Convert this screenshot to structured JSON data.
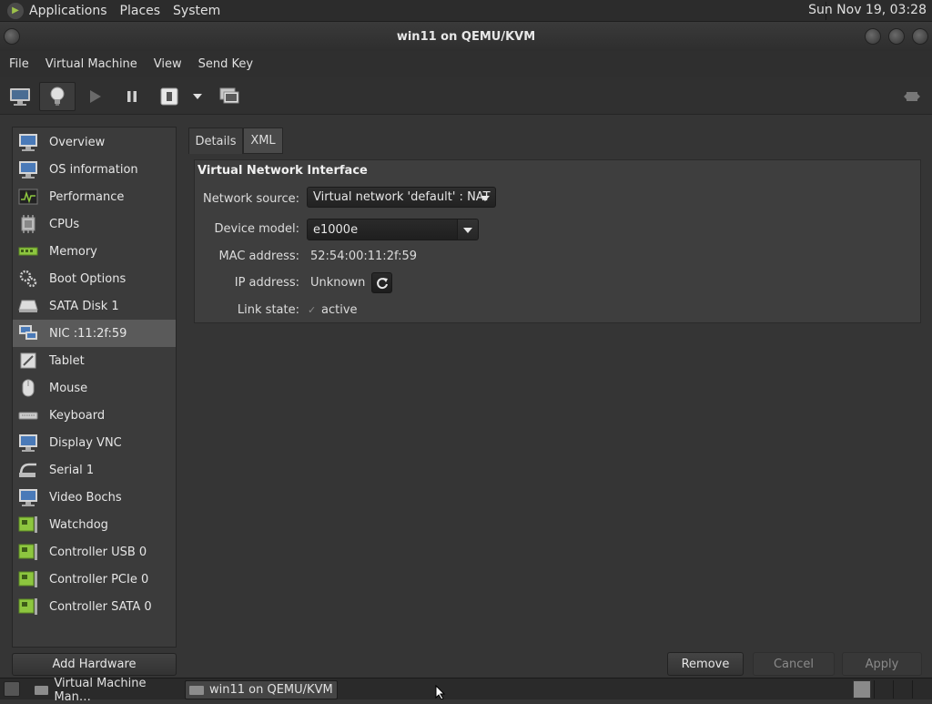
{
  "top_panel": {
    "menus": [
      "Applications",
      "Places",
      "System"
    ],
    "clock": "Sun Nov 19, 03:28"
  },
  "window": {
    "title": "win11 on QEMU/KVM"
  },
  "menubar": [
    "File",
    "Virtual Machine",
    "View",
    "Send Key"
  ],
  "sidebar": {
    "items": [
      {
        "label": "Overview",
        "icon": "monitor-icon"
      },
      {
        "label": "OS information",
        "icon": "monitor-icon"
      },
      {
        "label": "Performance",
        "icon": "performance-graph-icon"
      },
      {
        "label": "CPUs",
        "icon": "cpu-chip-icon"
      },
      {
        "label": "Memory",
        "icon": "memory-stick-icon"
      },
      {
        "label": "Boot Options",
        "icon": "gears-icon"
      },
      {
        "label": "SATA Disk 1",
        "icon": "hard-disk-icon"
      },
      {
        "label": "NIC :11:2f:59",
        "icon": "network-icon"
      },
      {
        "label": "Tablet",
        "icon": "tablet-icon"
      },
      {
        "label": "Mouse",
        "icon": "mouse-icon"
      },
      {
        "label": "Keyboard",
        "icon": "keyboard-icon"
      },
      {
        "label": "Display VNC",
        "icon": "monitor-icon"
      },
      {
        "label": "Serial 1",
        "icon": "serial-port-icon"
      },
      {
        "label": "Video Bochs",
        "icon": "monitor-icon"
      },
      {
        "label": "Watchdog",
        "icon": "pci-card-icon"
      },
      {
        "label": "Controller USB 0",
        "icon": "pci-card-icon"
      },
      {
        "label": "Controller PCIe 0",
        "icon": "pci-card-icon"
      },
      {
        "label": "Controller SATA 0",
        "icon": "pci-card-icon"
      }
    ],
    "selected": "NIC :11:2f:59"
  },
  "tabs": [
    "Details",
    "XML"
  ],
  "panel": {
    "section_title": "Virtual Network Interface",
    "network_source_label": "Network source:",
    "network_source_value": "Virtual network 'default' : NAT",
    "device_model_label": "Device model:",
    "device_model_value": "e1000e",
    "mac_label": "MAC address:",
    "mac_value": "52:54:00:11:2f:59",
    "ip_label": "IP address:",
    "ip_value": "Unknown",
    "link_label": "Link state:",
    "link_value": "active"
  },
  "buttons": {
    "add_hardware": "Add Hardware",
    "remove": "Remove",
    "cancel": "Cancel",
    "apply": "Apply"
  },
  "taskbar": {
    "tasks": [
      "Virtual Machine Man…",
      "win11 on QEMU/KVM"
    ]
  },
  "colors": {
    "background": "#353535",
    "sidebar_selected": "#5a5a5a",
    "panel": "#3e3e3e",
    "icon_green": "#8dc63f",
    "icon_blue": "#5a8fc8"
  }
}
